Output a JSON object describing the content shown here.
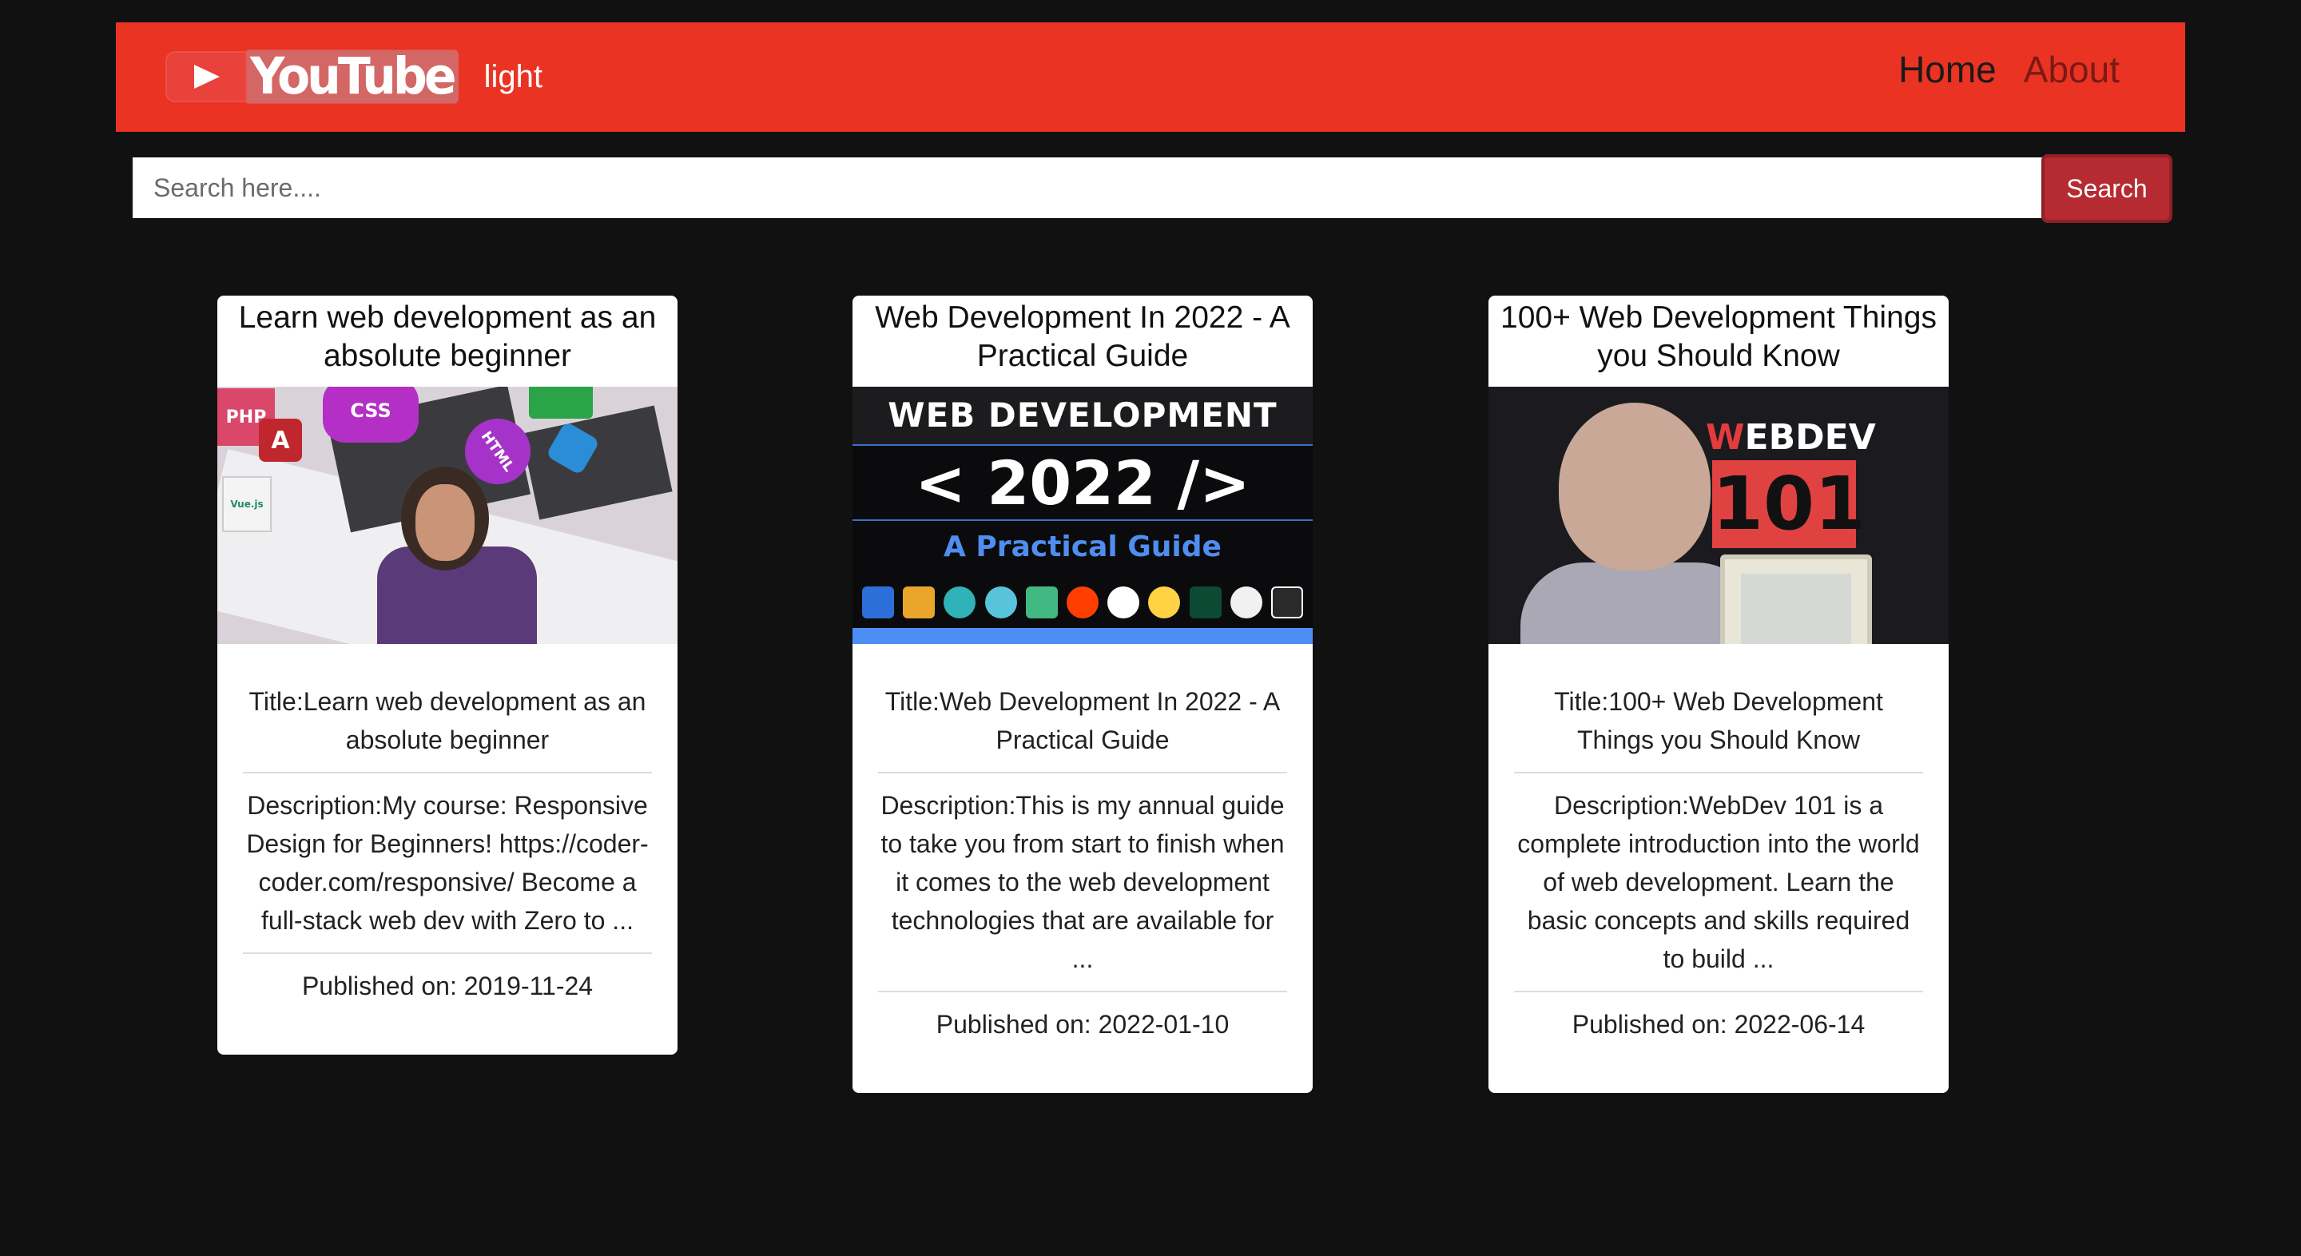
{
  "navbar": {
    "logo_text": "YouTube",
    "brand_sub": "light",
    "links": {
      "home": "Home",
      "about": "About"
    }
  },
  "search": {
    "placeholder": "Search here....",
    "button_label": "Search"
  },
  "videos": [
    {
      "heading": "Learn web development as an absolute beginner",
      "title_line": "Title:Learn web development as an absolute beginner",
      "description_line": "Description:My course: Responsive Design for Beginners! https://coder-coder.com/responsive/ Become a full-stack web dev with Zero to ...",
      "published_line": "Published on: 2019-11-24",
      "thumb_labels": {
        "php": "PHP",
        "angular": "A",
        "css": "CSS",
        "html": "HTML",
        "vue": "Vue.js"
      }
    },
    {
      "heading": "Web Development In 2022 - A Practical Guide",
      "title_line": "Title:Web Development In 2022 - A Practical Guide",
      "description_line": "Description:This is my annual guide to take you from start to finish when it comes to the web development technologies that are available for ...",
      "published_line": "Published on: 2022-01-10",
      "thumb_labels": {
        "top": "WEB DEVELOPMENT",
        "year": "< 2022 />",
        "guide": "A Practical Guide"
      }
    },
    {
      "heading": "100+ Web Development Things you Should Know",
      "title_line": "Title:100+ Web Development Things you Should Know",
      "description_line": "Description:WebDev 101 is a complete introduction into the world of web development. Learn the basic concepts and skills required to build ...",
      "published_line": "Published on: 2022-06-14",
      "thumb_labels": {
        "webdev_w": "W",
        "webdev_rest": "EBDEV",
        "number": "101"
      }
    }
  ],
  "colors": {
    "page_bg": "#111111",
    "navbar_bg": "#ea3323",
    "search_button_bg": "#b62b32",
    "card_bg": "#ffffff"
  }
}
